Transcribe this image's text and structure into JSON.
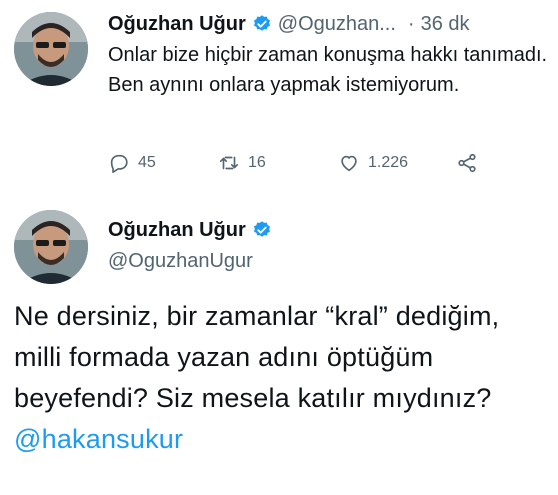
{
  "tweets": [
    {
      "author_name": "Oğuzhan Uğur",
      "handle": "@Oguzhan...",
      "separator": "·",
      "time": "36 dk",
      "text": "Onlar bize hiçbir zaman konuşma hakkı tanımadı. Ben aynını onlara yapmak istemiyorum.",
      "actions": {
        "reply_count": "45",
        "retweet_count": "16",
        "like_count": "1.226"
      },
      "icons": [
        "reply-icon",
        "retweet-icon",
        "like-icon",
        "share-icon"
      ]
    },
    {
      "author_name": "Oğuzhan Uğur",
      "handle": "@OguzhanUgur",
      "text_before": "Ne dersiniz, bir zamanlar “kral” dediğim, milli formada yazan adını öptüğüm beyefendi? Siz mesela katılır mıydınız? ",
      "mention": "@hakansukur"
    }
  ],
  "colors": {
    "text": "#0f1419",
    "secondary": "#536471",
    "accent": "#1d9bf0"
  }
}
